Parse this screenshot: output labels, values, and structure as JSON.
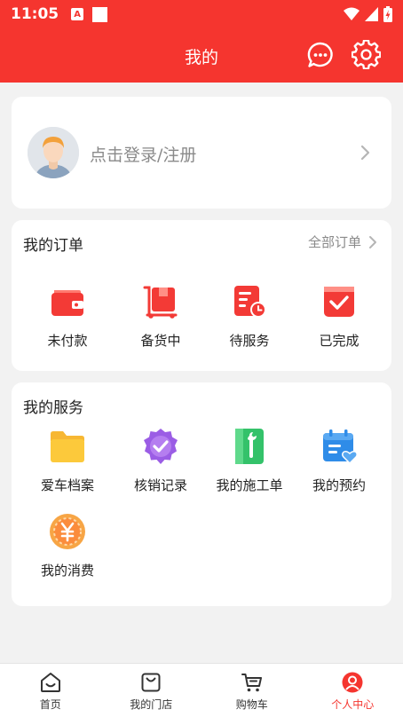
{
  "status_bar": {
    "time": "11:05",
    "notification_letter": "A"
  },
  "header": {
    "title": "我的"
  },
  "login": {
    "prompt": "点击登录/注册"
  },
  "orders": {
    "title": "我的订单",
    "all_label": "全部订单",
    "items": [
      {
        "label": "未付款",
        "icon": "wallet-icon"
      },
      {
        "label": "备货中",
        "icon": "cart-box-icon"
      },
      {
        "label": "待服务",
        "icon": "clock-doc-icon"
      },
      {
        "label": "已完成",
        "icon": "check-box-icon"
      }
    ]
  },
  "services": {
    "title": "我的服务",
    "items": [
      {
        "label": "爱车档案",
        "icon": "folder-icon"
      },
      {
        "label": "核销记录",
        "icon": "badge-check-icon"
      },
      {
        "label": "我的施工单",
        "icon": "wrench-doc-icon"
      },
      {
        "label": "我的预约",
        "icon": "calendar-heart-icon"
      },
      {
        "label": "我的消费",
        "icon": "yuan-coin-icon"
      }
    ]
  },
  "tabbar": {
    "active": "个人中心",
    "tabs": [
      {
        "label": "首页",
        "icon": "home-icon"
      },
      {
        "label": "我的门店",
        "icon": "bag-icon"
      },
      {
        "label": "购物车",
        "icon": "cart-icon"
      },
      {
        "label": "个人中心",
        "icon": "user-circle-icon"
      }
    ]
  },
  "colors": {
    "brand_red": "#f5352f",
    "background": "#f2f2f2",
    "muted_text": "#8a8a8a"
  }
}
